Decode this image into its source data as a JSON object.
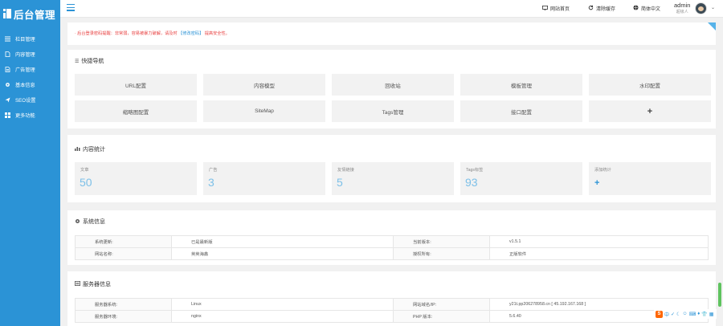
{
  "app": {
    "logo_text": "后台管理"
  },
  "sidebar": {
    "items": [
      {
        "label": "栏目管理",
        "icon": "list-icon"
      },
      {
        "label": "内容管理",
        "icon": "document-icon"
      },
      {
        "label": "广告管理",
        "icon": "file-icon"
      },
      {
        "label": "基本信息",
        "icon": "gear-icon"
      },
      {
        "label": "SEO设置",
        "icon": "send-icon"
      },
      {
        "label": "更多功能",
        "icon": "grid-icon"
      }
    ]
  },
  "topbar": {
    "site_home": "网站首页",
    "clear_cache": "清除缓存",
    "language": "简体中文",
    "user_name": "admin",
    "user_role": "超级人"
  },
  "notice": {
    "text_before": "· 后台登录密码提醒：非常弱，容易被暴力破解，请及时",
    "link": "【修改密码】",
    "text_after": "提高安全性。"
  },
  "quick_nav": {
    "title": "快捷导航",
    "items": [
      "URL配置",
      "内容模型",
      "回收站",
      "模板管理",
      "水印配置",
      "缩略图配置",
      "SiteMap",
      "Tags管理",
      "接口配置",
      "+"
    ]
  },
  "stats": {
    "title": "内容统计",
    "cards": [
      {
        "label": "文章",
        "value": "50"
      },
      {
        "label": "广告",
        "value": "3"
      },
      {
        "label": "友情链接",
        "value": "5"
      },
      {
        "label": "Tags标签",
        "value": "93"
      },
      {
        "label": "添加统计",
        "value": "+"
      }
    ]
  },
  "system_info": {
    "title": "系统信息",
    "rows": [
      {
        "k1": "系统更新:",
        "v1": "已是最新版",
        "k2": "当前版本:",
        "v2": "v1.5.1"
      },
      {
        "k1": "网站名称:",
        "v1": "英英海鑫",
        "k2": "授权所有:",
        "v2": "正版软件"
      }
    ]
  },
  "server_info": {
    "title": "服务器信息",
    "rows": [
      {
        "k1": "服务器系统:",
        "v1": "Linux",
        "k2": "网站域名/IP:",
        "v2": "y21t.pp206278958.cn [ 45.192.167.168 ]"
      },
      {
        "k1": "服务器环境:",
        "v1": "nginx",
        "k2": "PHP 版本:",
        "v2": "5.6.40"
      }
    ]
  },
  "ime": {
    "labels": [
      "S",
      "中",
      "✓",
      "☾",
      "☺",
      "⌨",
      "♦",
      "👕",
      "▦"
    ]
  },
  "colors": {
    "accent": "#2b93d6",
    "warning": "#e84040",
    "stat_value": "#7dc0e8"
  }
}
